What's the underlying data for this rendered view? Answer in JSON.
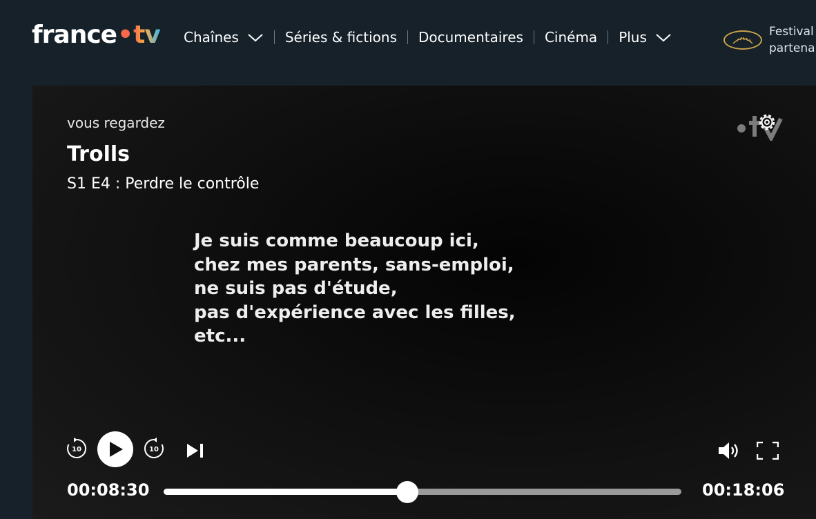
{
  "brand": {
    "word": "france",
    "dot": "•",
    "suffix": "tv"
  },
  "nav": {
    "items": [
      {
        "label": "Chaînes",
        "dropdown": true
      },
      {
        "label": "Séries & fictions",
        "dropdown": false
      },
      {
        "label": "Documentaires",
        "dropdown": false
      },
      {
        "label": "Cinéma",
        "dropdown": false
      },
      {
        "label": "Plus",
        "dropdown": true
      }
    ],
    "festival": {
      "line1": "Festival",
      "line2": "partena"
    }
  },
  "player": {
    "eyebrow": "vous regardez",
    "title": "Trolls",
    "episode": "S1 E4 : Perdre le contrôle",
    "subtitles": "Je suis comme beaucoup ici,\nchez mes parents, sans-emploi,\nne suis pas d'étude,\npas d'expérience avec les filles,\netc...",
    "skip_seconds": "10",
    "elapsed": "00:08:30",
    "remaining": "00:18:06",
    "progress_fraction": 0.47
  },
  "colors": {
    "background": "#16212a",
    "accent_orange": "#f8694b",
    "accent_blue": "#3cb9e6",
    "palm_gold": "#c9a44a"
  },
  "icons": [
    "chevron-down-icon",
    "palm-icon",
    "settings-icon",
    "replay-10-icon",
    "play-icon",
    "forward-10-icon",
    "next-episode-icon",
    "volume-icon",
    "fullscreen-icon"
  ]
}
